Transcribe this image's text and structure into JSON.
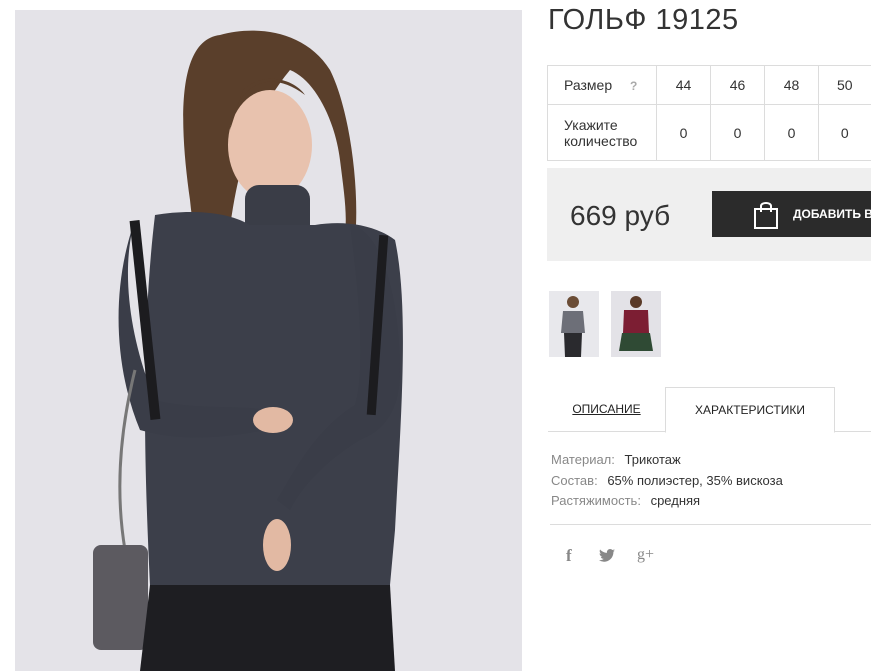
{
  "product": {
    "title": "ГОЛЬФ 19125",
    "price": "669 руб",
    "add_to_cart_label": "ДОБАВИТЬ В КОРЗИНУ"
  },
  "size_table": {
    "size_label": "Размер",
    "help": "?",
    "quantity_label_line1": "Укажите",
    "quantity_label_line2": "количество",
    "sizes": [
      "44",
      "46",
      "48",
      "50"
    ],
    "quantities": [
      "0",
      "0",
      "0",
      "0"
    ]
  },
  "tabs": {
    "description": "ОПИСАНИЕ",
    "characteristics": "ХАРАКТЕРИСТИКИ"
  },
  "specs": [
    {
      "key": "Материал:",
      "value": "Трикотаж"
    },
    {
      "key": "Состав:",
      "value": "65% полиэстер, 35% вискоза"
    },
    {
      "key": "Растяжимость:",
      "value": "средняя"
    }
  ],
  "social": {
    "facebook": "f",
    "googleplus": "g+"
  },
  "icons": {
    "cart": "shopping-bag-icon",
    "facebook": "facebook-icon",
    "twitter": "twitter-icon",
    "googleplus": "googleplus-icon"
  },
  "colors": {
    "button_bg": "#2b2b2b",
    "price_box_bg": "#efefef",
    "border": "#dcdcdc",
    "muted_text": "#888888"
  }
}
